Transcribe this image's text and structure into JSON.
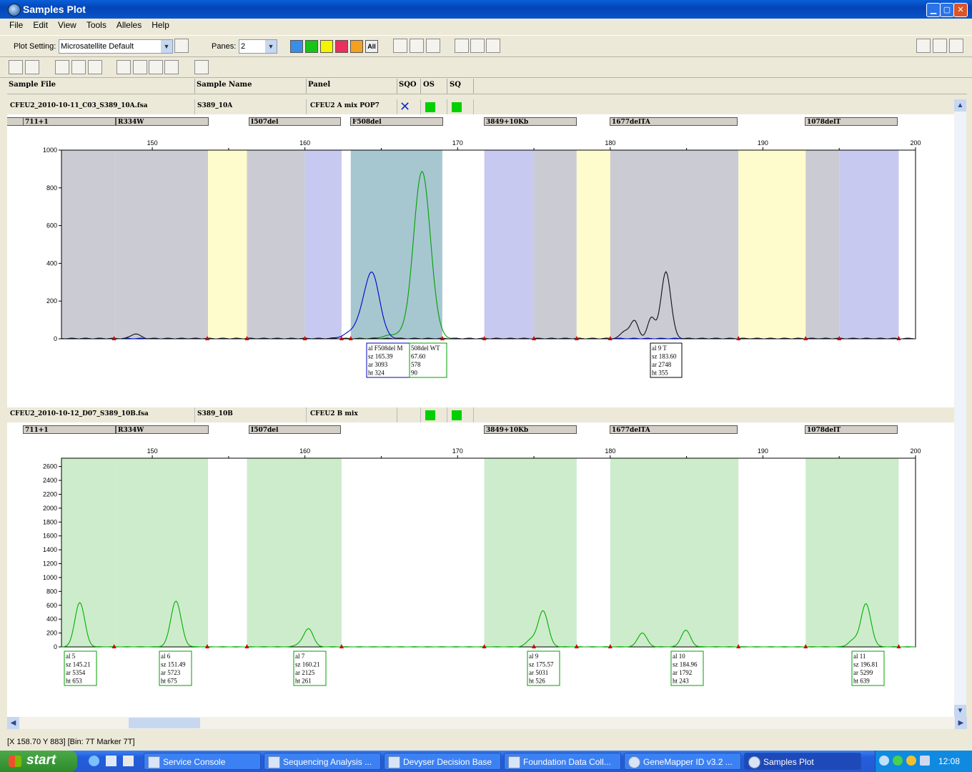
{
  "window": {
    "title": "Samples Plot"
  },
  "menu": [
    "File",
    "Edit",
    "View",
    "Tools",
    "Alleles",
    "Help"
  ],
  "toolbar": {
    "plot_setting_label": "Plot Setting:",
    "plot_setting_value": "Microsatellite Default",
    "panes_label": "Panes:",
    "panes_value": "2",
    "all_label": "All",
    "dye_colors": [
      "#3b8ee8",
      "#18c418",
      "#f4f400",
      "#e83060",
      "#f4a020"
    ]
  },
  "columns": {
    "sample_file": "Sample File",
    "sample_name": "Sample Name",
    "panel": "Panel",
    "sqo": "SQO",
    "os": "OS",
    "sq": "SQ"
  },
  "axis": {
    "x_ticks": [
      150,
      160,
      170,
      180,
      190,
      200
    ]
  },
  "panes": [
    {
      "sample_file": "CFEU2_2010-10-11_C03_S389_10A.fsa",
      "sample_name": "S389_10A",
      "panel": "CFEU2 A mix POP7",
      "sqo": "✕",
      "markers": [
        "711+1",
        "R334W",
        "I507del",
        "F508del",
        "3849+10Kb",
        "1677delTA",
        "1078delT"
      ],
      "y_ticks": [
        0,
        200,
        400,
        600,
        800,
        1000
      ],
      "labels": [
        {
          "lines": [
            "al F508del M",
            "sz 165.39",
            "ar 3093",
            "ht 324"
          ]
        },
        {
          "lines": [
            "508del WT",
            "67.60",
            "578",
            "90"
          ]
        },
        {
          "lines": [
            "al 9 T",
            "sz 183.60",
            "ar 2748",
            "ht 355"
          ]
        }
      ]
    },
    {
      "sample_file": "CFEU2_2010-10-12_D07_S389_10B.fsa",
      "sample_name": "S389_10B",
      "panel": "CFEU2 B mix",
      "markers": [
        "711+1",
        "R334W",
        "I507del",
        "3849+10Kb",
        "1677delTA",
        "1078delT"
      ],
      "y_ticks": [
        0,
        200,
        400,
        600,
        800,
        1000,
        1200,
        1400,
        1600,
        1800,
        2000,
        2200,
        2400,
        2600
      ],
      "labels": [
        {
          "lines": [
            "al 5",
            "sz 145.21",
            "ar 5354",
            "ht 653"
          ]
        },
        {
          "lines": [
            "al 6",
            "sz 151.49",
            "ar 5723",
            "ht 675"
          ]
        },
        {
          "lines": [
            "al 7",
            "sz 160.21",
            "ar 2125",
            "ht 261"
          ]
        },
        {
          "lines": [
            "al 9",
            "sz 175.57",
            "ar 5031",
            "ht 526"
          ]
        },
        {
          "lines": [
            "al 10",
            "sz 184.96",
            "ar 1792",
            "ht 243"
          ]
        },
        {
          "lines": [
            "al 11",
            "sz 196.81",
            "ar 5299",
            "ht 639"
          ]
        }
      ]
    }
  ],
  "status_bar": "[X 158.70  Y 883]  [Bin: 7T Marker 7T]",
  "taskbar": {
    "start": "start",
    "tasks": [
      "Service Console",
      "Sequencing Analysis ...",
      "Devyser Decision Base",
      "Foundation Data Coll...",
      "GeneMapper ID v3.2 ...",
      "Samples Plot"
    ],
    "clock": "12:08"
  }
}
